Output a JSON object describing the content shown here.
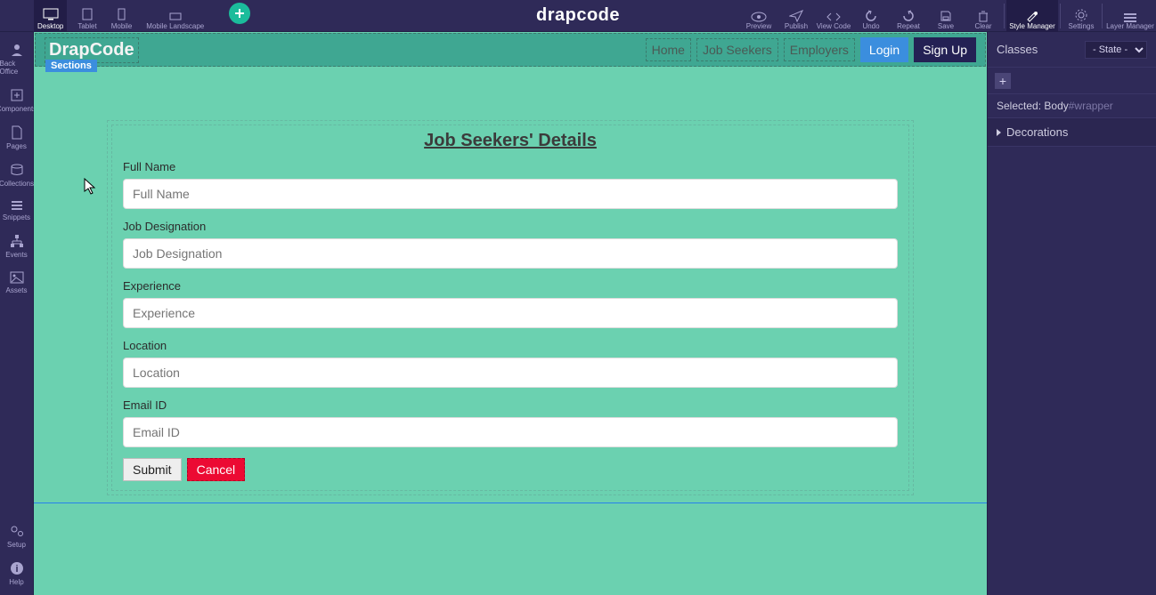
{
  "topbar": {
    "devices": [
      {
        "label": "Desktop"
      },
      {
        "label": "Tablet"
      },
      {
        "label": "Mobile"
      },
      {
        "label": "Mobile Landscape"
      }
    ],
    "brand": "drapcode",
    "tools": [
      {
        "label": "Preview"
      },
      {
        "label": "Publish"
      },
      {
        "label": "View Code"
      },
      {
        "label": "Undo"
      },
      {
        "label": "Repeat"
      },
      {
        "label": "Save"
      },
      {
        "label": "Clear"
      },
      {
        "label": "Style Manager"
      },
      {
        "label": "Settings"
      },
      {
        "label": "Layer Manager"
      }
    ]
  },
  "leftrail": [
    {
      "label": "Back Office"
    },
    {
      "label": "Components"
    },
    {
      "label": "Pages"
    },
    {
      "label": "Collections"
    },
    {
      "label": "Snippets"
    },
    {
      "label": "Events"
    },
    {
      "label": "Assets"
    }
  ],
  "leftrail_bottom": [
    {
      "label": "Setup"
    },
    {
      "label": "Help"
    }
  ],
  "canvas": {
    "site_brand": "DrapCode",
    "sections_tag": "Sections",
    "nav_items": [
      "Home",
      "Job Seekers",
      "Employers"
    ],
    "login_label": "Login",
    "signup_label": "Sign Up",
    "form_title": "Job Seekers' Details",
    "fields": [
      {
        "label": "Full Name",
        "placeholder": "Full Name"
      },
      {
        "label": "Job Designation",
        "placeholder": "Job Designation"
      },
      {
        "label": "Experience",
        "placeholder": "Experience"
      },
      {
        "label": "Location",
        "placeholder": "Location"
      },
      {
        "label": "Email ID",
        "placeholder": "Email ID"
      }
    ],
    "submit_label": "Submit",
    "cancel_label": "Cancel"
  },
  "rightpanel": {
    "classes_label": "Classes",
    "state_label": "- State -",
    "selected_prefix": "Selected:",
    "selected_el": "Body",
    "selected_id": "#wrapper",
    "decorations_label": "Decorations"
  }
}
